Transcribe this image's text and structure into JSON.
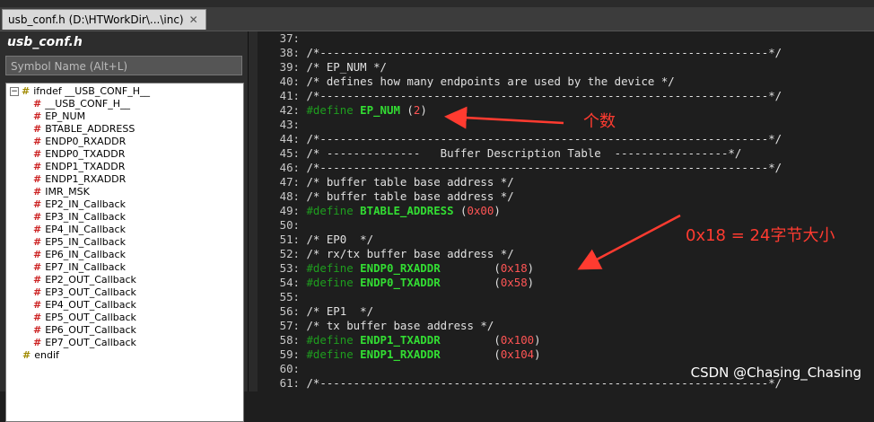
{
  "tab": {
    "label": "usb_conf.h (D:\\HTWorkDir\\...\\inc)",
    "close": "✕"
  },
  "sidebar": {
    "title": "usb_conf.h",
    "search_placeholder": "Symbol Name (Alt+L)",
    "tree": [
      {
        "label": "ifndef __USB_CONF_H__",
        "kind": "directive",
        "level": 0
      },
      {
        "label": "__USB_CONF_H__",
        "kind": "macro",
        "level": 1
      },
      {
        "label": "EP_NUM",
        "kind": "macro",
        "level": 1
      },
      {
        "label": "BTABLE_ADDRESS",
        "kind": "macro",
        "level": 1
      },
      {
        "label": "ENDP0_RXADDR",
        "kind": "macro",
        "level": 1
      },
      {
        "label": "ENDP0_TXADDR",
        "kind": "macro",
        "level": 1
      },
      {
        "label": "ENDP1_TXADDR",
        "kind": "macro",
        "level": 1
      },
      {
        "label": "ENDP1_RXADDR",
        "kind": "macro",
        "level": 1
      },
      {
        "label": "IMR_MSK",
        "kind": "macro",
        "level": 1
      },
      {
        "label": "EP2_IN_Callback",
        "kind": "macro",
        "level": 1
      },
      {
        "label": "EP3_IN_Callback",
        "kind": "macro",
        "level": 1
      },
      {
        "label": "EP4_IN_Callback",
        "kind": "macro",
        "level": 1
      },
      {
        "label": "EP5_IN_Callback",
        "kind": "macro",
        "level": 1
      },
      {
        "label": "EP6_IN_Callback",
        "kind": "macro",
        "level": 1
      },
      {
        "label": "EP7_IN_Callback",
        "kind": "macro",
        "level": 1
      },
      {
        "label": "EP2_OUT_Callback",
        "kind": "macro",
        "level": 1
      },
      {
        "label": "EP3_OUT_Callback",
        "kind": "macro",
        "level": 1
      },
      {
        "label": "EP4_OUT_Callback",
        "kind": "macro",
        "level": 1
      },
      {
        "label": "EP5_OUT_Callback",
        "kind": "macro",
        "level": 1
      },
      {
        "label": "EP6_OUT_Callback",
        "kind": "macro",
        "level": 1
      },
      {
        "label": "EP7_OUT_Callback",
        "kind": "macro",
        "level": 1
      },
      {
        "label": "endif",
        "kind": "directive",
        "level": 0
      }
    ]
  },
  "code": [
    {
      "n": "37:",
      "parts": []
    },
    {
      "n": "38:",
      "parts": [
        {
          "t": "c",
          "v": "/*-------------------------------------------------------------------*/"
        }
      ]
    },
    {
      "n": "39:",
      "parts": [
        {
          "t": "c",
          "v": "/* EP_NUM */"
        }
      ]
    },
    {
      "n": "40:",
      "parts": [
        {
          "t": "c",
          "v": "/* defines how many endpoints are used by the device */"
        }
      ]
    },
    {
      "n": "41:",
      "parts": [
        {
          "t": "c",
          "v": "/*-------------------------------------------------------------------*/"
        }
      ]
    },
    {
      "n": "42:",
      "parts": [
        {
          "t": "d",
          "v": "#define "
        },
        {
          "t": "m",
          "v": "EP_NUM"
        },
        {
          "t": "p",
          "v": " ("
        },
        {
          "t": "n",
          "v": "2"
        },
        {
          "t": "p",
          "v": ")"
        }
      ]
    },
    {
      "n": "43:",
      "parts": []
    },
    {
      "n": "44:",
      "parts": [
        {
          "t": "c",
          "v": "/*-------------------------------------------------------------------*/"
        }
      ]
    },
    {
      "n": "45:",
      "parts": [
        {
          "t": "c",
          "v": "/* --------------   Buffer Description Table  -----------------*/"
        }
      ]
    },
    {
      "n": "46:",
      "parts": [
        {
          "t": "c",
          "v": "/*-------------------------------------------------------------------*/"
        }
      ]
    },
    {
      "n": "47:",
      "parts": [
        {
          "t": "c",
          "v": "/* buffer table base address */"
        }
      ]
    },
    {
      "n": "48:",
      "parts": [
        {
          "t": "c",
          "v": "/* buffer table base address */"
        }
      ]
    },
    {
      "n": "49:",
      "parts": [
        {
          "t": "d",
          "v": "#define "
        },
        {
          "t": "m",
          "v": "BTABLE_ADDRESS"
        },
        {
          "t": "p",
          "v": " ("
        },
        {
          "t": "n",
          "v": "0x00"
        },
        {
          "t": "p",
          "v": ")"
        }
      ]
    },
    {
      "n": "50:",
      "parts": []
    },
    {
      "n": "51:",
      "parts": [
        {
          "t": "c",
          "v": "/* EP0  */"
        }
      ]
    },
    {
      "n": "52:",
      "parts": [
        {
          "t": "c",
          "v": "/* rx/tx buffer base address */"
        }
      ]
    },
    {
      "n": "53:",
      "parts": [
        {
          "t": "d",
          "v": "#define "
        },
        {
          "t": "m",
          "v": "ENDP0_RXADDR"
        },
        {
          "t": "p",
          "v": "        ("
        },
        {
          "t": "n",
          "v": "0x18"
        },
        {
          "t": "p",
          "v": ")"
        }
      ]
    },
    {
      "n": "54:",
      "parts": [
        {
          "t": "d",
          "v": "#define "
        },
        {
          "t": "m",
          "v": "ENDP0_TXADDR"
        },
        {
          "t": "p",
          "v": "        ("
        },
        {
          "t": "n",
          "v": "0x58"
        },
        {
          "t": "p",
          "v": ")"
        }
      ]
    },
    {
      "n": "55:",
      "parts": []
    },
    {
      "n": "56:",
      "parts": [
        {
          "t": "c",
          "v": "/* EP1  */"
        }
      ]
    },
    {
      "n": "57:",
      "parts": [
        {
          "t": "c",
          "v": "/* tx buffer base address */"
        }
      ]
    },
    {
      "n": "58:",
      "parts": [
        {
          "t": "d",
          "v": "#define "
        },
        {
          "t": "m",
          "v": "ENDP1_TXADDR"
        },
        {
          "t": "p",
          "v": "        ("
        },
        {
          "t": "n",
          "v": "0x100"
        },
        {
          "t": "p",
          "v": ")"
        }
      ]
    },
    {
      "n": "59:",
      "parts": [
        {
          "t": "d",
          "v": "#define "
        },
        {
          "t": "m",
          "v": "ENDP1_RXADDR"
        },
        {
          "t": "p",
          "v": "        ("
        },
        {
          "t": "n",
          "v": "0x104"
        },
        {
          "t": "p",
          "v": ")"
        }
      ]
    },
    {
      "n": "60:",
      "parts": []
    },
    {
      "n": "61:",
      "parts": [
        {
          "t": "c",
          "v": "/*-------------------------------------------------------------------*/"
        }
      ]
    }
  ],
  "annotations": {
    "count_label": "个数",
    "size_label": "0x18 = 24字节大小",
    "color": "#ff3b30"
  },
  "watermark": "CSDN @Chasing_Chasing"
}
